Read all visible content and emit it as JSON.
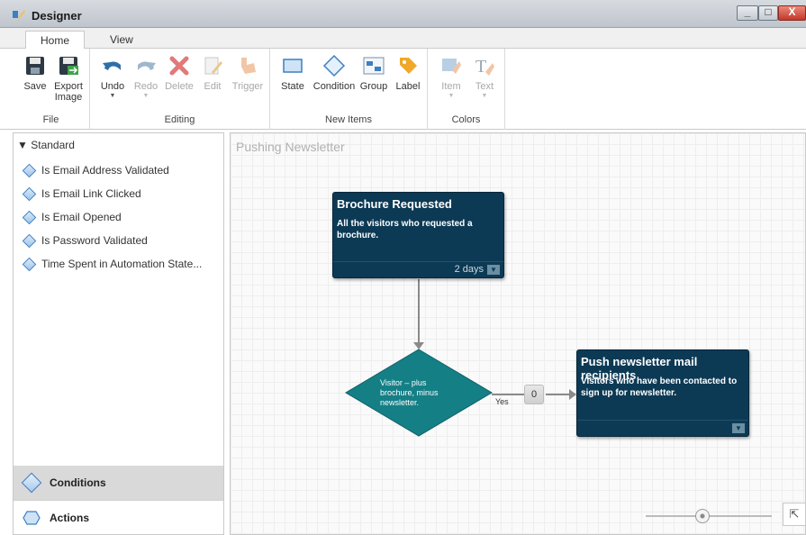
{
  "window": {
    "title": "Designer",
    "minimize": "_",
    "maximize": "□",
    "close": "X"
  },
  "ribbon_tabs": [
    "Home",
    "View"
  ],
  "ribbon": {
    "file": {
      "name": "File",
      "save": "Save",
      "export": "Export Image"
    },
    "editing": {
      "name": "Editing",
      "undo": "Undo",
      "redo": "Redo",
      "delete": "Delete",
      "edit": "Edit",
      "trigger": "Trigger"
    },
    "new_items": {
      "name": "New Items",
      "state": "State",
      "condition": "Condition",
      "group": "Group",
      "label": "Label"
    },
    "colors": {
      "name": "Colors",
      "item": "Item",
      "text": "Text"
    }
  },
  "sidebar": {
    "section": "Standard",
    "items": [
      "Is Email Address Validated",
      "Is Email Link Clicked",
      "Is Email Opened",
      "Is Password Validated",
      "Time Spent in Automation State..."
    ],
    "conditions": "Conditions",
    "actions": "Actions"
  },
  "canvas": {
    "title": "Pushing Newsletter",
    "state1": {
      "title": "Brochure Requested",
      "body": "All the visitors who requested a brochure.",
      "duration": "2 days"
    },
    "decision": {
      "label": "Visitor – plus brochure, minus newsletter.",
      "yes": "Yes",
      "count": "0"
    },
    "state2": {
      "title": "Push newsletter mail recipients",
      "body": "Visitors who have been contacted to sign up for newsletter."
    },
    "fit": "⇱"
  },
  "colors": {
    "node": "#0c3a55",
    "decision": "#157f86",
    "accent": "#3d7fc1"
  },
  "zoom_level": 0.45
}
